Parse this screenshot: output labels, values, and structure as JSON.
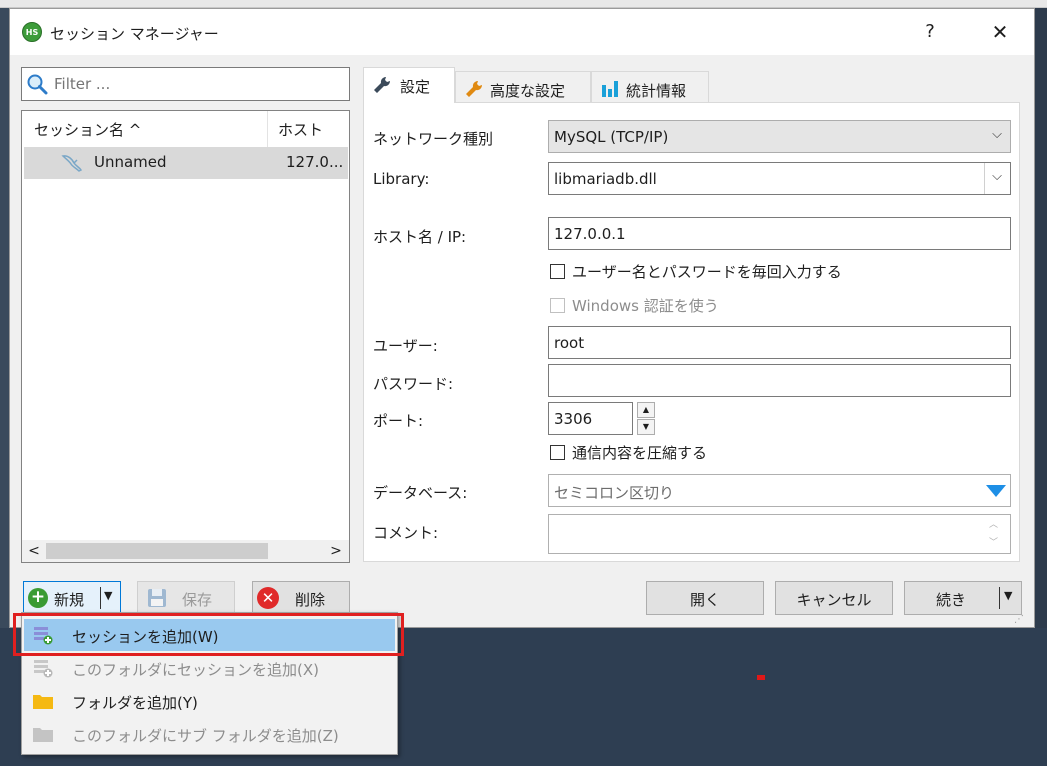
{
  "window": {
    "title": "セッション マネージャー",
    "help": "?",
    "close": "✕",
    "icon_text": "HS"
  },
  "filter": {
    "placeholder": "Filter ..."
  },
  "session_list": {
    "columns": [
      "セッション名 ^",
      "ホスト"
    ],
    "rows": [
      {
        "name": "Unnamed",
        "host": "127.0..."
      }
    ],
    "scroll_left": "<",
    "scroll_right": ">"
  },
  "left_buttons": {
    "new": "新規",
    "save": "保存",
    "delete": "削除"
  },
  "tabs": [
    {
      "label": "設定"
    },
    {
      "label": "高度な設定"
    },
    {
      "label": "統計情報"
    }
  ],
  "form": {
    "network_type": {
      "label": "ネットワーク種別",
      "value": "MySQL (TCP/IP)"
    },
    "library": {
      "label": "Library:",
      "value": "libmariadb.dll"
    },
    "host": {
      "label": "ホスト名 / IP:",
      "value": "127.0.0.1"
    },
    "prompt_credentials": {
      "label": "ユーザー名とパスワードを毎回入力する"
    },
    "windows_auth": {
      "label": "Windows 認証を使う"
    },
    "user": {
      "label": "ユーザー:",
      "value": "root"
    },
    "password": {
      "label": "パスワード:",
      "value": ""
    },
    "port": {
      "label": "ポート:",
      "value": "3306"
    },
    "compress": {
      "label": "通信内容を圧縮する"
    },
    "database": {
      "label": "データベース:",
      "placeholder": "セミコロン区切り"
    },
    "comment": {
      "label": "コメント:",
      "value": ""
    }
  },
  "action_buttons": {
    "open": "開く",
    "cancel": "キャンセル",
    "next": "続き"
  },
  "menu": [
    {
      "label": "セッションを追加(W)"
    },
    {
      "label": "このフォルダにセッションを追加(X)"
    },
    {
      "label": "フォルダを追加(Y)"
    },
    {
      "label": "このフォルダにサブ フォルダを追加(Z)"
    }
  ],
  "colors": {
    "accent": "#0078d7",
    "highlight": "#e02020",
    "menu_selected": "#99c9ef"
  }
}
